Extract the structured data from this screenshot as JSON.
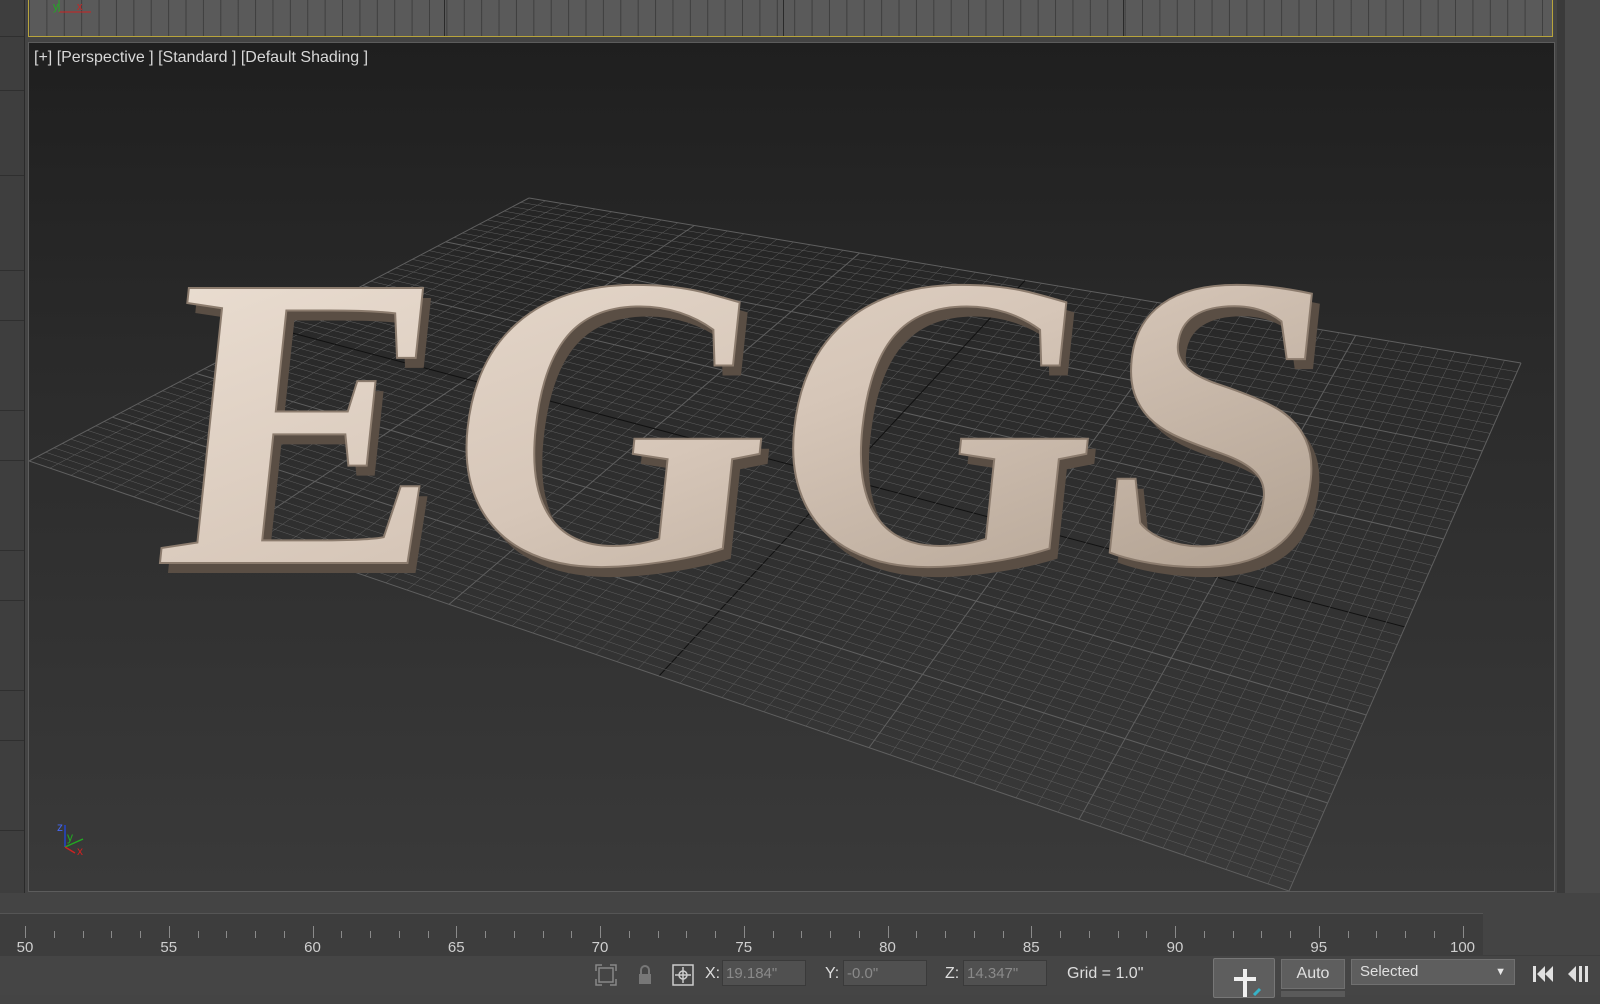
{
  "viewport": {
    "label_plus": "[+]",
    "label_view": "[Perspective ]",
    "label_renderer": "[Standard ]",
    "label_shading": "[Default Shading ]",
    "scene_text": "EGGS",
    "axis_x": "x",
    "axis_y": "y",
    "axis_z": "z"
  },
  "top_viewport": {
    "axis_y": "y",
    "axis_x": "x"
  },
  "timeline": {
    "labels": [
      "50",
      "55",
      "60",
      "65",
      "70",
      "75",
      "80",
      "85",
      "90",
      "95",
      "100"
    ]
  },
  "status_bar": {
    "x_label": "X:",
    "x_value": "19.184\"",
    "y_label": "Y:",
    "y_value": "-0.0\"",
    "z_label": "Z:",
    "z_value": "14.347\"",
    "grid_label": "Grid = 1.0\"",
    "auto_label": "Auto",
    "selected_label": "Selected",
    "dropdown_arrow": "▼"
  },
  "icons": {
    "selection_frame": "selection-frame-icon",
    "lock": "lock-icon",
    "absolute_mode": "absolute-mode-icon",
    "set_key": "set-key-icon",
    "goto_start": "goto-start-icon",
    "previous_frame": "previous-frame-icon"
  },
  "colors": {
    "viewport_border_active": "#b8a43c",
    "text_material": "#d9c9bc",
    "axis_x": "#cc2222",
    "axis_y": "#22aa22",
    "axis_z": "#2244cc"
  }
}
